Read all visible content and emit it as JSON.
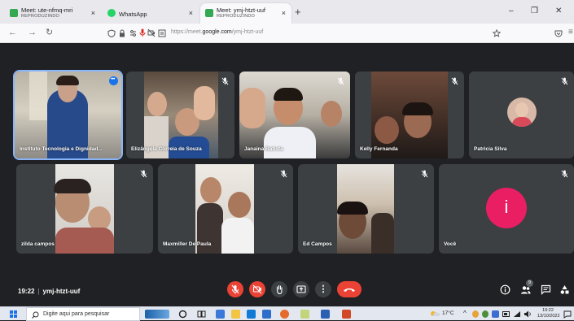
{
  "browser": {
    "tabs": [
      {
        "title": "Meet: ute-nfmq-mri",
        "subtitle": "REPRODUZINDO",
        "favicon": "meet-icon"
      },
      {
        "title": "WhatsApp",
        "subtitle": "",
        "favicon": "whatsapp-icon"
      },
      {
        "title": "Meet: ymj-htzt-uuf",
        "subtitle": "REPRODUZINDO",
        "favicon": "meet-icon",
        "active": true
      }
    ],
    "close_glyph": "×",
    "new_tab_glyph": "+",
    "window_controls": {
      "minimize": "–",
      "maximize": "❐",
      "close": "✕"
    },
    "url_prefix": "https://meet.",
    "url_domain": "google.com",
    "url_path": "/ymj-htzt-uuf"
  },
  "meet": {
    "participants": [
      {
        "name": "Instituto Tecnologia e Dignidad...",
        "speaking": true
      },
      {
        "name": "Elizângela Correia de Souza"
      },
      {
        "name": "Janaina Batista"
      },
      {
        "name": "Kelly Fernanda"
      },
      {
        "name": "Patricia Silva"
      },
      {
        "name": "zilda campos"
      },
      {
        "name": "Maxmiller De Paula"
      },
      {
        "name": "Ed Campos"
      },
      {
        "name": "Você",
        "avatar_letter": "i"
      }
    ],
    "meeting_time": "19:22",
    "meeting_code": "ymj-htzt-uuf",
    "participant_badge": "9",
    "more_options_glyph": "⋮"
  },
  "taskbar": {
    "search_placeholder": "Digite aqui para pesquisar",
    "temperature": "17°C",
    "clock_time": "19:22",
    "clock_date": "13/10/2022"
  },
  "colors": {
    "meet_bg": "#202124",
    "tile_bg": "#3c4043",
    "accent_red": "#ea4335",
    "avatar_pink": "#e91e63",
    "speaking_outline": "#8ab4f8"
  }
}
